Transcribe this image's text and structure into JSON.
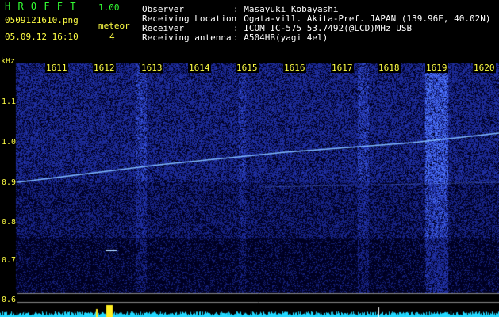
{
  "header": {
    "app_name": "H R O F F T",
    "version": "1.00",
    "filename": "0509121610.png",
    "datetime": "05.09.12 16:10",
    "meteor_label": "meteor",
    "meteor_count": "4",
    "info": [
      {
        "label": "Observer",
        "value": ": Masayuki Kobayashi"
      },
      {
        "label": "Receiving Location",
        "value": ": Ogata-vill. Akita-Pref. JAPAN (139.96E, 40.02N)"
      },
      {
        "label": "Receiver",
        "value": ": ICOM IC-575 53.7492(@LCD)MHz USB"
      },
      {
        "label": "Receiving antenna",
        "value": ": A504HB(yagi 4el)"
      }
    ]
  },
  "axis": {
    "unit": "kHz",
    "freq_ticks": [
      "1.1",
      "1.0",
      "0.9",
      "0.8",
      "0.7",
      "0.6"
    ],
    "time_ticks": [
      "1611",
      "1612",
      "1613",
      "1614",
      "1615",
      "1616",
      "1617",
      "1618",
      "1619",
      "1620"
    ]
  },
  "colors": {
    "background": "#000000",
    "text_green": "#33ff33",
    "text_yellow": "#ffff44",
    "noise_blue": "#2a3ad8",
    "trail": "#7fb8ff",
    "level_cyan": "#22d8ff"
  }
}
